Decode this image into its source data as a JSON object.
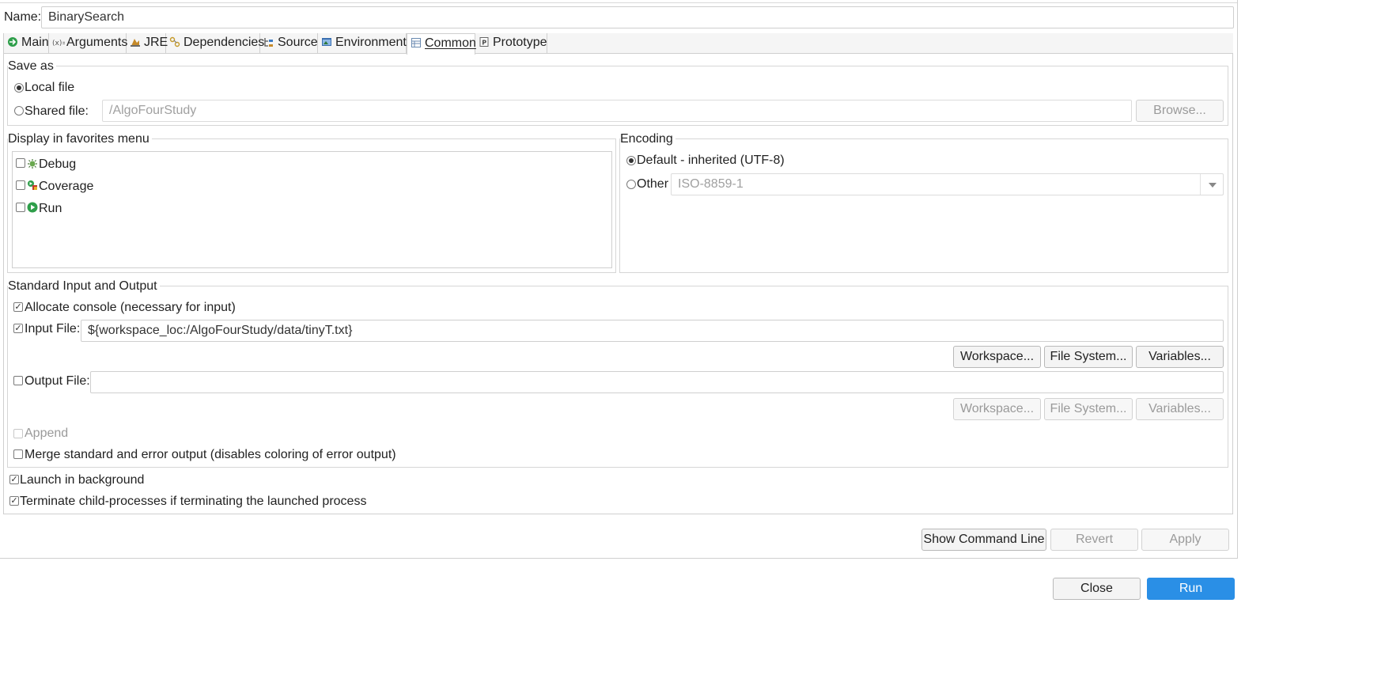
{
  "name_field": {
    "label": "Name:",
    "value": "BinarySearch"
  },
  "tabs": [
    {
      "label": "Main",
      "icon": "main-icon"
    },
    {
      "label": "Arguments",
      "icon": "arguments-icon"
    },
    {
      "label": "JRE",
      "icon": "jre-icon"
    },
    {
      "label": "Dependencies",
      "icon": "dependencies-icon"
    },
    {
      "label": "Source",
      "icon": "source-icon"
    },
    {
      "label": "Environment",
      "icon": "environment-icon"
    },
    {
      "label": "Common",
      "icon": "common-icon",
      "active": true
    },
    {
      "label": "Prototype",
      "icon": "prototype-icon"
    }
  ],
  "save_as": {
    "title": "Save as",
    "local_file": "Local file",
    "shared_file": "Shared file:",
    "shared_path": "/AlgoFourStudy",
    "browse": "Browse..."
  },
  "favorites": {
    "title": "Display in favorites menu",
    "items": [
      {
        "label": "Debug",
        "icon": "debug-icon",
        "checked": false
      },
      {
        "label": "Coverage",
        "icon": "coverage-icon",
        "checked": false
      },
      {
        "label": "Run",
        "icon": "run-icon",
        "checked": false
      }
    ]
  },
  "encoding": {
    "title": "Encoding",
    "default_label": "Default - inherited (UTF-8)",
    "other_label": "Other",
    "other_value": "ISO-8859-1"
  },
  "std_io": {
    "title": "Standard Input and Output",
    "allocate_console": "Allocate console (necessary for input)",
    "input_file_label": "Input File:",
    "input_file_value": "${workspace_loc:/AlgoFourStudy/data/tinyT.txt}",
    "output_file_label": "Output File:",
    "output_file_value": "",
    "workspace": "Workspace...",
    "file_system": "File System...",
    "variables": "Variables...",
    "append": "Append",
    "merge": "Merge standard and error output (disables coloring of error output)"
  },
  "launch_in_background": "Launch in background",
  "terminate_children": "Terminate child-processes if terminating the launched process",
  "bottom_buttons": {
    "show_command_line": "Show Command Line",
    "revert": "Revert",
    "apply": "Apply",
    "close": "Close",
    "run": "Run"
  },
  "colors": {
    "primary": "#2a8fe6",
    "border": "#cfcfcf",
    "disabled_text": "#9a9a9a"
  }
}
